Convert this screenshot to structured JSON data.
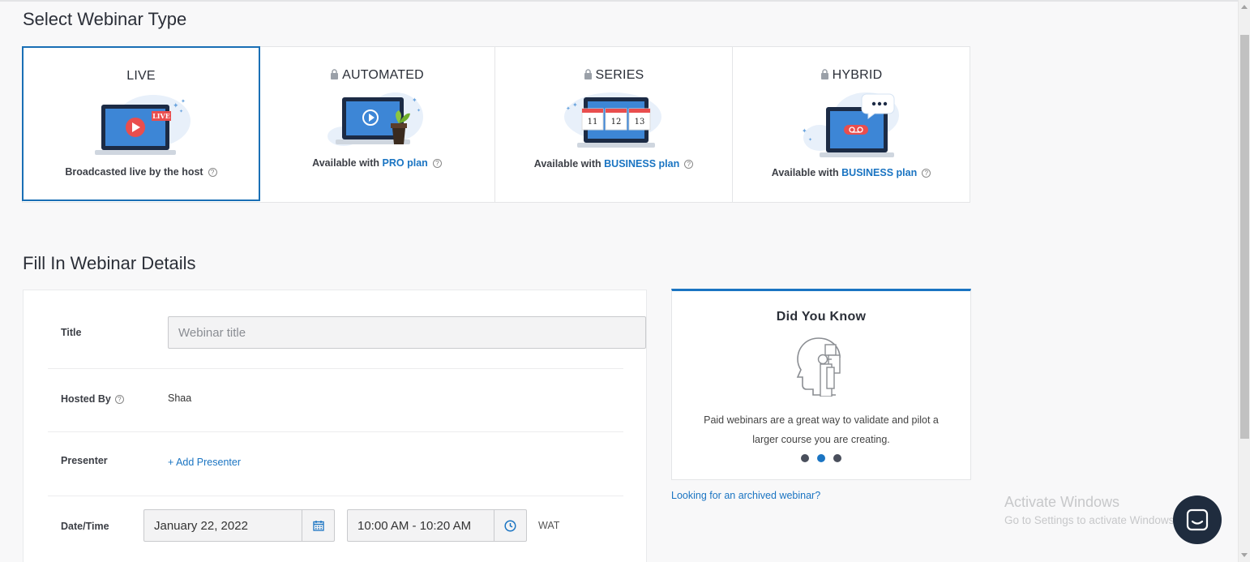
{
  "section_titles": {
    "select_type": "Select Webinar Type",
    "details": "Fill In Webinar Details"
  },
  "webinar_types": [
    {
      "name": "LIVE",
      "locked": false,
      "selected": true,
      "desc": "Broadcasted live by the host",
      "live_badge": "LIVE"
    },
    {
      "name": "AUTOMATED",
      "locked": true,
      "selected": false,
      "desc_prefix": "Available with ",
      "plan": "PRO plan"
    },
    {
      "name": "SERIES",
      "locked": true,
      "selected": false,
      "desc_prefix": "Available with ",
      "plan": "BUSINESS plan",
      "dates": [
        "11",
        "12",
        "13"
      ]
    },
    {
      "name": "HYBRID",
      "locked": true,
      "selected": false,
      "desc_prefix": "Available with ",
      "plan": "BUSINESS plan"
    }
  ],
  "form": {
    "title_label": "Title",
    "title_placeholder": "Webinar title",
    "title_value": "",
    "hosted_by_label": "Hosted By",
    "hosted_by_value": "Shaa",
    "presenter_label": "Presenter",
    "add_presenter": "+ Add Presenter",
    "datetime_label": "Date/Time",
    "date_value": "January 22, 2022",
    "time_value": "10:00 AM - 10:20 AM",
    "timezone": "WAT"
  },
  "did_you_know": {
    "title": "Did You Know",
    "text": "Paid webinars are a great way to validate and pilot a larger course you are creating.",
    "dots": 3,
    "active_dot": 1
  },
  "archived_link": "Looking for an archived webinar?",
  "watermark": {
    "line1": "Activate Windows",
    "line2": "Go to Settings to activate Windows."
  },
  "colors": {
    "accent": "#1a74c2",
    "selected_border": "#1a6fb5",
    "chat_button": "#1f2c3e"
  }
}
